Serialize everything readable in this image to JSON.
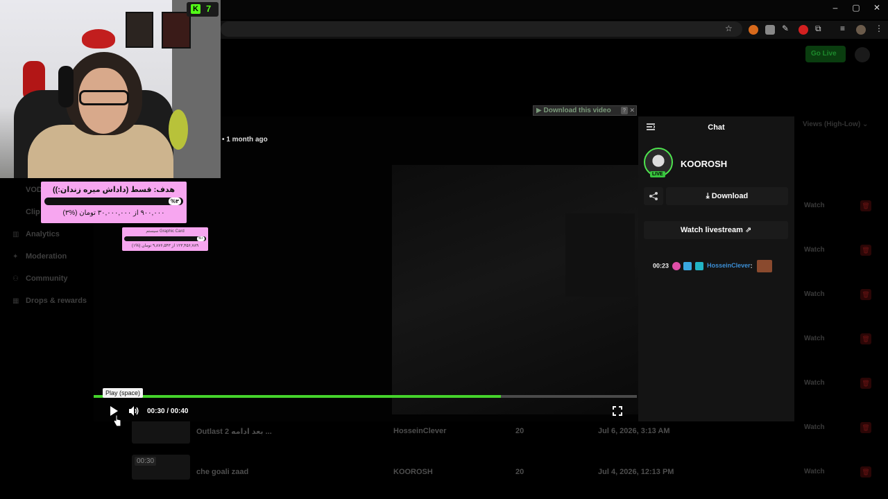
{
  "browser": {
    "window_controls": [
      "–",
      "▢",
      "✕"
    ]
  },
  "header": {
    "go_live_label": "Go Live"
  },
  "sidebar": {
    "items": [
      {
        "label": "VOD",
        "icon": "video-icon"
      },
      {
        "label": "Clip",
        "icon": "clip-icon"
      },
      {
        "label": "Analytics",
        "icon": "analytics-icon"
      },
      {
        "label": "Moderation",
        "icon": "wrench-icon"
      },
      {
        "label": "Community",
        "icon": "people-icon"
      },
      {
        "label": "Drops & rewards",
        "icon": "gift-icon"
      }
    ]
  },
  "stream_overlay": {
    "kick_count": "7",
    "goal": {
      "title": "هدف: قسط (داداش میره زندان:))",
      "percent_label": "%۳",
      "amount": "۹۰۰,۰۰۰ از ۳۰,۰۰۰,۰۰۰ تومان (%۳)",
      "progress": 0.03
    },
    "goal2": {
      "title": "Graphic Card سیستم",
      "percent_label": "%۱",
      "amount": "۱۲۳,۴۵۶,۷۸۹ از ۹,۸۷۶,۵۴۳ تومان (%۱)",
      "progress": 0.01
    }
  },
  "player": {
    "posted": "1 month ago",
    "download_video_label": "Download this video",
    "help_label": "?",
    "close_label": "✕",
    "time_display": "00:30 / 00:40",
    "progress": 0.75,
    "tooltip": "Play (space)",
    "accent": "#45d32b"
  },
  "chat": {
    "title": "Chat",
    "streamer": "KOOROSH",
    "live_badge": "LIVE",
    "download_label": "Download",
    "watch_livestream_label": "Watch livestream",
    "message": {
      "time": "00:23",
      "user": "HosseinClever",
      "separator": ":"
    }
  },
  "table": {
    "sort_label": "Views (High-Low)",
    "watch_label": "Watch",
    "rows": [
      {
        "title": "Outlast 2 بعد ادامه ...",
        "creator": "HosseinClever",
        "views": "20",
        "date": "Jul 6, 2026, 3:13 AM",
        "duration": ""
      },
      {
        "title": "che goali zaad",
        "creator": "KOOROSH",
        "views": "20",
        "date": "Jul 4, 2026, 12:13 PM",
        "duration": "00:30"
      }
    ]
  }
}
